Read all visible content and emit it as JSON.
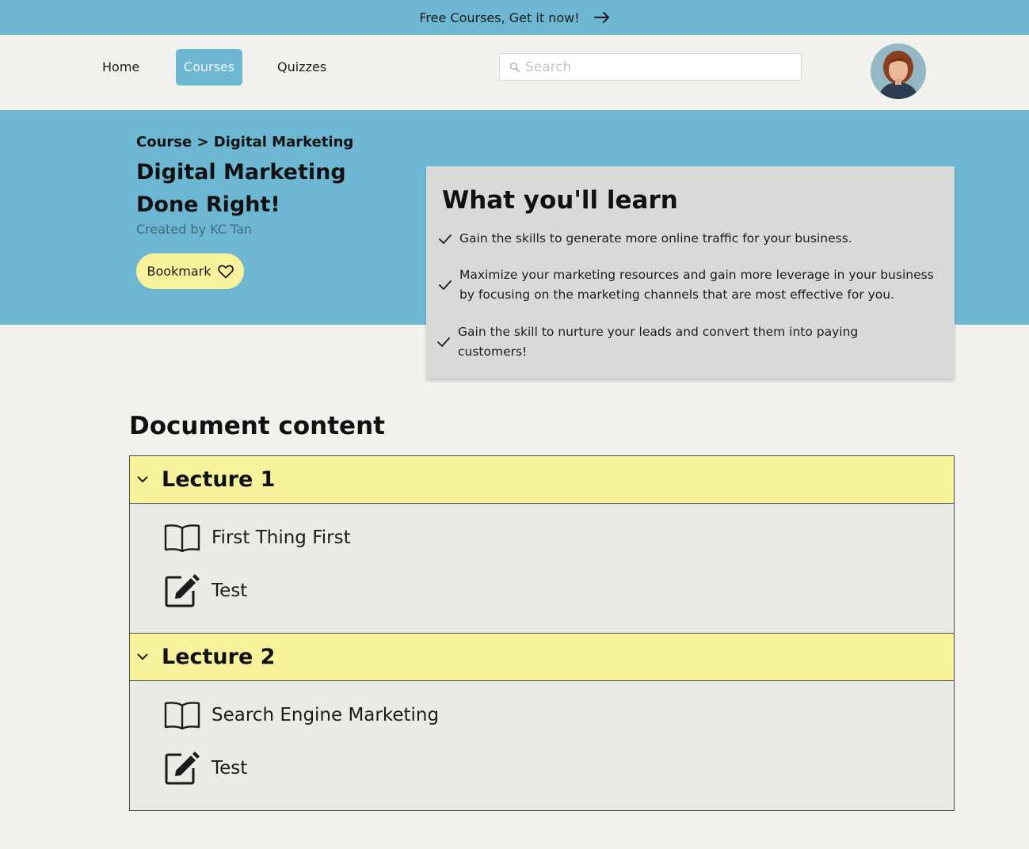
{
  "promo": {
    "text": "Free Courses, Get it now!",
    "icon": "arrow-right-icon"
  },
  "nav": {
    "items": [
      {
        "label": "Home"
      },
      {
        "label": "Courses",
        "active": true
      },
      {
        "label": "Quizzes"
      }
    ],
    "search": {
      "placeholder": "Search",
      "icon": "search-icon"
    },
    "avatar": "user-avatar"
  },
  "hero": {
    "breadcrumb": "Course > Digital Marketing",
    "title": "Digital Marketing Done Right!",
    "creator": "Created by KC Tan",
    "bookmark_label": "Bookmark",
    "bookmark_icon": "heart-icon"
  },
  "learn": {
    "title": "What you'll learn",
    "items": [
      "Gain the skills to generate more online traffic for your business.",
      "Maximize your marketing resources and gain more leverage in your business by focusing on the marketing channels that are most effective for you.",
      "Gain the skill to nurture your leads and convert them into paying customers!"
    ]
  },
  "content": {
    "title": "Document content",
    "lectures": [
      {
        "title": "Lecture 1",
        "items": [
          {
            "label": "First Thing First",
            "icon": "book-icon"
          },
          {
            "label": "Test",
            "icon": "edit-icon"
          }
        ]
      },
      {
        "title": "Lecture 2",
        "items": [
          {
            "label": "Search Engine Marketing",
            "icon": "book-icon"
          },
          {
            "label": "Test",
            "icon": "edit-icon"
          }
        ]
      }
    ]
  },
  "colors": {
    "accent_blue": "#6db7d3",
    "highlight_yellow": "#f8f29d",
    "page_bg": "#f2f1ed",
    "card_grey": "#d9d9d9"
  }
}
